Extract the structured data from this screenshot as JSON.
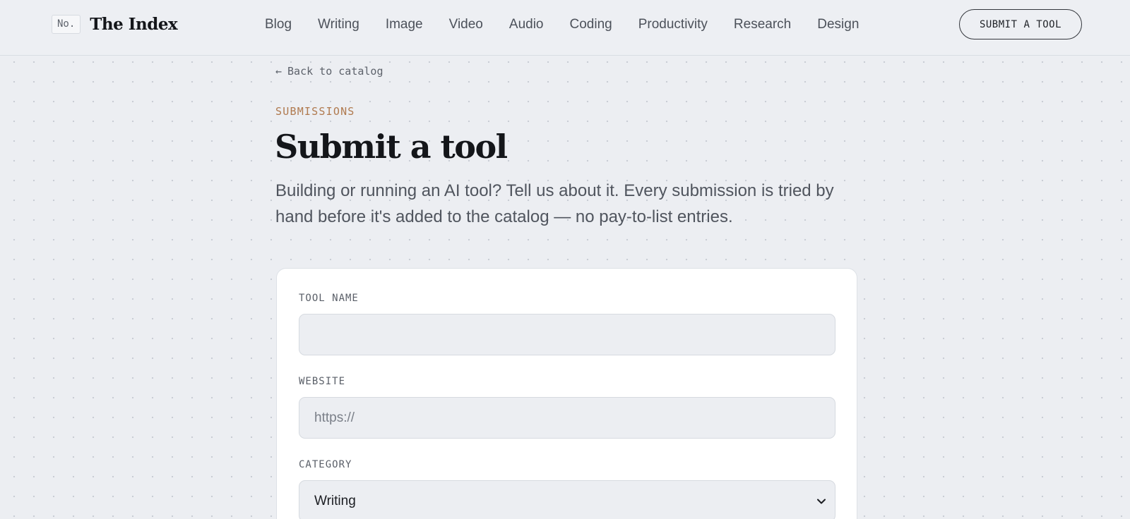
{
  "brand": {
    "badge": "No.",
    "name": "The Index"
  },
  "nav": {
    "items": [
      "Blog",
      "Writing",
      "Image",
      "Video",
      "Audio",
      "Coding",
      "Productivity",
      "Research",
      "Design"
    ]
  },
  "header": {
    "submit_label": "SUBMIT A TOOL"
  },
  "back_link": {
    "arrow": "←",
    "label": "Back to catalog"
  },
  "page": {
    "eyebrow": "SUBMISSIONS",
    "title": "Submit a tool",
    "intro": "Building or running an AI tool? Tell us about it. Every submission is tried by hand before it's added to the catalog — no pay-to-list entries."
  },
  "form": {
    "tool_name": {
      "label": "TOOL NAME",
      "value": "",
      "placeholder": ""
    },
    "website": {
      "label": "WEBSITE",
      "value": "",
      "placeholder": "https://"
    },
    "category": {
      "label": "CATEGORY",
      "selected": "Writing"
    }
  },
  "icons": {
    "back": "arrow-left-icon",
    "select": "chevron-down-icon"
  },
  "colors": {
    "background": "#eceef2",
    "accent_eyebrow": "#b07a4f",
    "text_primary": "#14161a",
    "text_muted": "#50555e",
    "card": "#ffffff"
  }
}
